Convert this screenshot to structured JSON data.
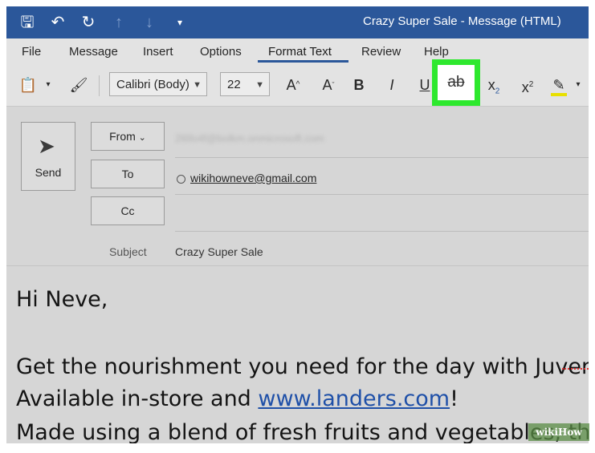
{
  "window": {
    "title": "Crazy Super Sale  -  Message (HTML)"
  },
  "qat": {
    "save_icon": "save-icon",
    "undo_icon": "undo-icon",
    "redo_icon": "redo-icon"
  },
  "menu": {
    "tabs": [
      "File",
      "Message",
      "Insert",
      "Options",
      "Format Text",
      "Review",
      "Help"
    ],
    "active": "Format Text"
  },
  "ribbon": {
    "font_name": "Calibri (Body)",
    "font_size": "22",
    "grow_font": "A",
    "shrink_font": "A",
    "bold": "B",
    "italic": "I",
    "underline": "U",
    "strikethrough": "ab",
    "subscript": "x",
    "superscript": "x",
    "subscript_mark": "2",
    "superscript_mark": "2"
  },
  "header": {
    "send_label": "Send",
    "from_label": "From",
    "from_value": "2l6fo4f@bolkm.onmicrosoft.com",
    "to_label": "To",
    "to_value": "wikihowneve@gmail.com",
    "cc_label": "Cc",
    "subject_label": "Subject",
    "subject_value": "Crazy Super Sale"
  },
  "body": {
    "greeting": "Hi Neve,",
    "line1": "Get the nourishment you need for the day with Juvenate",
    "line2_prefix": "Available in-store and ",
    "line2_link": "www.landers.com",
    "line2_suffix": "!",
    "line3": "Made using a blend of fresh fruits and vegetables, this"
  },
  "watermark": "wikiHow",
  "colors": {
    "titlebar": "#2b579a",
    "highlight_box": "#2ee82e",
    "link": "#1f50a8"
  }
}
